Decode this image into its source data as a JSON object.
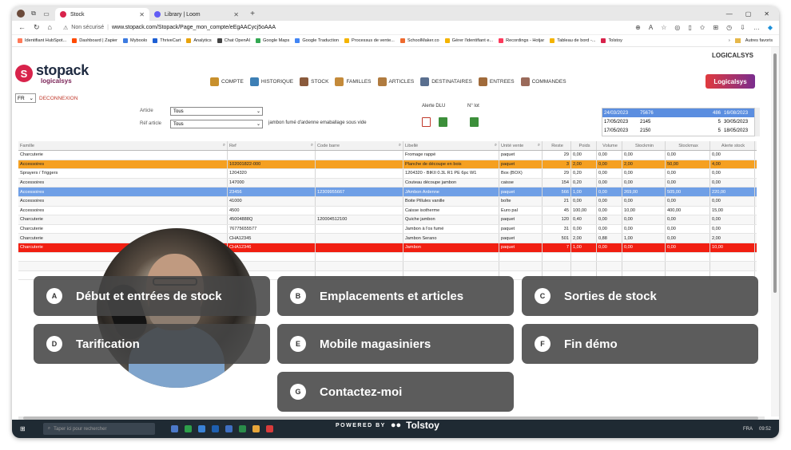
{
  "browser": {
    "tabs": [
      {
        "label": "Stock",
        "active": true,
        "favicon_color": "#d8234b"
      },
      {
        "label": "Library | Loom",
        "active": false,
        "favicon_color": "#625df5"
      }
    ],
    "address": {
      "security": "Non sécurisé",
      "url": "www.stopack.com/Stopack/Page_mon_compte/eEgAACycj5oAAA"
    },
    "bookmarks": [
      {
        "label": "Identifiant HubSpot...",
        "color": "#ff7a59"
      },
      {
        "label": "Dashboard | Zapier",
        "color": "#ff4a00"
      },
      {
        "label": "Myboolo",
        "color": "#3d7be0"
      },
      {
        "label": "ThriveCart",
        "color": "#1e5fd4"
      },
      {
        "label": "Analytics",
        "color": "#e8a30c"
      },
      {
        "label": "Chat OpenAI",
        "color": "#444444"
      },
      {
        "label": "Google Maps",
        "color": "#34a853"
      },
      {
        "label": "Google Traduction",
        "color": "#4285f4"
      },
      {
        "label": "Processus de vente...",
        "color": "#f4b400"
      },
      {
        "label": "SchoolMaker.co",
        "color": "#ee6a2e"
      },
      {
        "label": "Gérer l'identifiant e...",
        "color": "#f4b400"
      },
      {
        "label": "Recordings - Hotjar",
        "color": "#fd3a5c"
      },
      {
        "label": "Tableau de bord -...",
        "color": "#f4b400"
      },
      {
        "label": "Tolstoy",
        "color": "#d8234b"
      }
    ],
    "bookmarks_other": "Autres favoris"
  },
  "app": {
    "brand_top": "LOGICALSYS",
    "logo_name": "stopack",
    "logo_sub": "logicalsys",
    "badge": "Logicalsys",
    "menu": [
      {
        "label": "COMPTE",
        "color": "#c8902c"
      },
      {
        "label": "HISTORIQUE",
        "color": "#3d7fb5"
      },
      {
        "label": "STOCK",
        "color": "#8a5a3c"
      },
      {
        "label": "FAMILLES",
        "color": "#c48a3a"
      },
      {
        "label": "ARTICLES",
        "color": "#b07b3f"
      },
      {
        "label": "DESTINATAIRES",
        "color": "#5a6f8f"
      },
      {
        "label": "ENTREES",
        "color": "#a06a3a"
      },
      {
        "label": "COMMANDES",
        "color": "#9a6a5a"
      }
    ],
    "lang": "FR",
    "logout": "DECONNEXION"
  },
  "filters": {
    "article_label": "Article",
    "article_value": "Tous",
    "ref_label": "Réf article",
    "ref_value": "Tous",
    "description": "jambon fumé d'ardenne emaballage sous vide",
    "alert_label": "Alerte DLU",
    "lot_label": "N° lot"
  },
  "dlu_list": [
    {
      "date1": "24/03/2023",
      "ref": "75676",
      "qty": "486",
      "date2": "16/08/2023",
      "selected": true
    },
    {
      "date1": "17/05/2023",
      "ref": "2145",
      "qty": "5",
      "date2": "30/05/2023",
      "selected": false
    },
    {
      "date1": "17/05/2023",
      "ref": "2150",
      "qty": "5",
      "date2": "18/05/2023",
      "selected": false
    }
  ],
  "grid": {
    "headers": [
      "Famille",
      "Ref",
      "Code barre",
      "Libellé",
      "Unité vente",
      "Reste",
      "Poids",
      "Volume",
      "Stockmin",
      "Stockmax",
      "Alerte stock"
    ],
    "rows": [
      {
        "style": "normal",
        "cells": [
          "Charcuterie",
          "",
          "",
          "Fromage rappé",
          "paquet",
          "29",
          "0,00",
          "0,00",
          "0,00",
          "0,00",
          "0,00"
        ]
      },
      {
        "style": "orange",
        "cells": [
          "Accessoires",
          "102001822-000",
          "",
          "Planche de découpe en bois",
          "paquet",
          "3",
          "2,00",
          "0,00",
          "2,00",
          "50,00",
          "4,00"
        ]
      },
      {
        "style": "normal",
        "cells": [
          "Sprayers / Triggers",
          "1204320",
          "",
          "1204320 - BIKII 0.3L R1 PE 6pc W1",
          "Box (BOX)",
          "29",
          "0,20",
          "0,00",
          "0,00",
          "0,00",
          "0,00"
        ]
      },
      {
        "style": "normal",
        "cells": [
          "Accessoires",
          "147000",
          "",
          "Couteau découpe jambon",
          "caisse",
          "154",
          "0,20",
          "0,00",
          "0,00",
          "0,00",
          "0,00"
        ]
      },
      {
        "style": "blue",
        "cells": [
          "Accessoires",
          "23456",
          "12309955667",
          "JAmbon Ardenne",
          "paquet",
          "566",
          "1,00",
          "0,00",
          "269,00",
          "505,00",
          "220,00"
        ]
      },
      {
        "style": "normal",
        "cells": [
          "Accessoires",
          "41000",
          "",
          "Boite Pillules vanille",
          "boîte",
          "21",
          "0,00",
          "0,00",
          "0,00",
          "0,00",
          "0,00"
        ]
      },
      {
        "style": "normal",
        "cells": [
          "Accessoires",
          "4500",
          "",
          "Caisse isotherme",
          "Euro pal",
          "45",
          "100,00",
          "0,00",
          "10,00",
          "400,00",
          "15,00"
        ]
      },
      {
        "style": "normal",
        "cells": [
          "Charcuterie",
          "45004888Q",
          "120004512100",
          "Quiche jambon",
          "paquet",
          "120",
          "0,40",
          "0,00",
          "0,00",
          "0,00",
          "0,00"
        ]
      },
      {
        "style": "normal",
        "cells": [
          "Charcuterie",
          "76775655577",
          "",
          "Jambon à l'os fumé",
          "paquet",
          "31",
          "0,00",
          "0,00",
          "0,00",
          "0,00",
          "0,00"
        ]
      },
      {
        "style": "normal",
        "cells": [
          "Charcuterie",
          "CHA12345",
          "",
          "Jambon Serano",
          "paquet",
          "501",
          "2,00",
          "0,88",
          "1,00",
          "0,00",
          "2,00"
        ]
      },
      {
        "style": "red",
        "cells": [
          "Charcuterie",
          "CHA12346",
          "",
          "Jambon",
          "paquet",
          "7",
          "1,00",
          "0,00",
          "0,00",
          "0,00",
          "10,00"
        ]
      }
    ]
  },
  "overlay": {
    "options": [
      {
        "key": "A",
        "label": "Début et entrées de stock"
      },
      {
        "key": "B",
        "label": "Emplacements et articles"
      },
      {
        "key": "C",
        "label": "Sorties de stock"
      },
      {
        "key": "D",
        "label": "Tarification"
      },
      {
        "key": "E",
        "label": "Mobile magasiniers"
      },
      {
        "key": "F",
        "label": "Fin démo"
      },
      {
        "key": "G",
        "label": "Contactez-moi"
      }
    ],
    "powered_prefix": "POWERED BY",
    "powered_brand": "Tolstoy"
  },
  "taskbar": {
    "search_placeholder": "Taper ici pour rechercher",
    "lang": "FRA",
    "time": "09:52"
  }
}
